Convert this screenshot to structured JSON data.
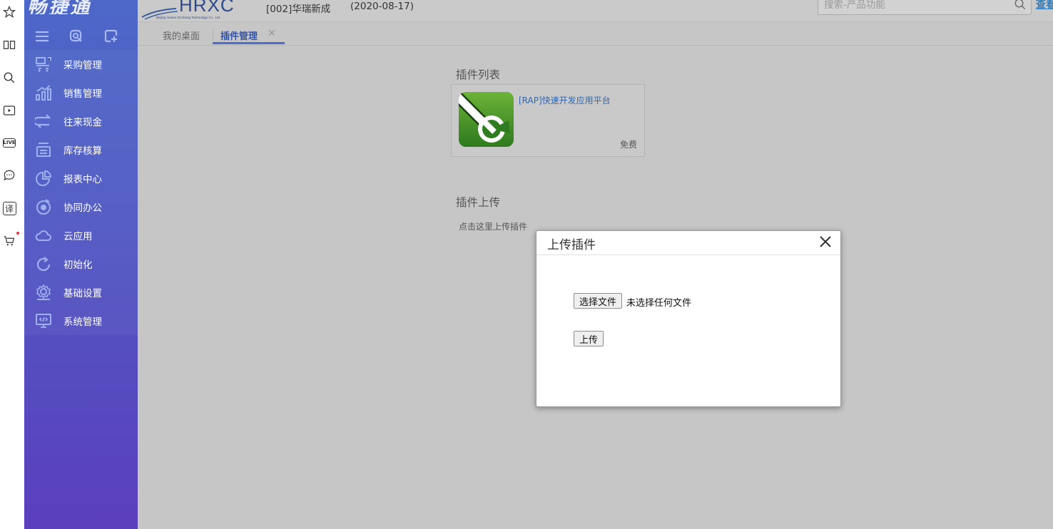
{
  "browser_strip": {
    "icons": [
      "star-icon",
      "book-icon",
      "search-icon",
      "video-icon",
      "live-icon",
      "chat-icon",
      "translate-icon",
      "cart-icon"
    ],
    "live_label": "LIVE",
    "translate_label": "译"
  },
  "sidebar": {
    "brand": "畅捷通",
    "tools": [
      "menu-icon",
      "search-icon",
      "add-icon"
    ],
    "items": [
      {
        "label": "采购管理",
        "icon": "purchase-icon"
      },
      {
        "label": "销售管理",
        "icon": "sales-icon"
      },
      {
        "label": "往来现金",
        "icon": "exchange-icon"
      },
      {
        "label": "库存核算",
        "icon": "inventory-icon"
      },
      {
        "label": "报表中心",
        "icon": "report-icon"
      },
      {
        "label": "协同办公",
        "icon": "collaboration-icon"
      },
      {
        "label": "云应用",
        "icon": "cloud-icon"
      },
      {
        "label": "初始化",
        "icon": "refresh-icon"
      },
      {
        "label": "基础设置",
        "icon": "settings-icon"
      },
      {
        "label": "系统管理",
        "icon": "system-icon"
      }
    ]
  },
  "header": {
    "logo_text": "HRXC",
    "logo_subtext": "Beijing Huarui Xincheng Technology Co., Ltd.",
    "company": "[002]华瑞新成",
    "date": "(2020-08-17)",
    "search_placeholder": "搜索-产品功能",
    "view_link": "查看"
  },
  "tabs": [
    {
      "label": "我的桌面",
      "active": false
    },
    {
      "label": "插件管理",
      "active": true
    }
  ],
  "content": {
    "plugin_list_title": "插件列表",
    "plugin": {
      "name": "[RAP]快速开发应用平台",
      "price": "免费"
    },
    "plugin_upload_title": "插件上传",
    "upload_hint": "点击这里上传插件"
  },
  "dialog": {
    "title": "上传插件",
    "choose_file_label": "选择文件",
    "file_status": "未选择任何文件",
    "upload_label": "上传"
  },
  "colors": {
    "sidebar_top": "#4d68c8",
    "sidebar_bottom": "#5b3fbd",
    "overlay_bg": "#c6c6c7",
    "accent": "#4a6ed0",
    "link": "#2e66b0",
    "plugin_green": "#3d8a2a"
  }
}
